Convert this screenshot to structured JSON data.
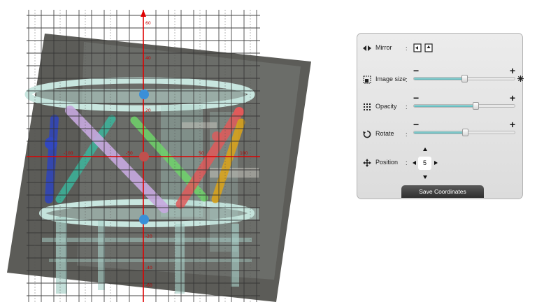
{
  "viewer": {
    "x_ticks": [
      "-100",
      "-50",
      "50",
      "100"
    ],
    "y_ticks_top": [
      "60",
      "40",
      "20"
    ],
    "y_ticks_bottom": [
      "-20",
      "-40",
      "-60"
    ]
  },
  "panel": {
    "mirror": {
      "label": "Mirror",
      "icon": "mirror-icon"
    },
    "image_size": {
      "label": "Image size",
      "minus": "−",
      "plus": "+",
      "value": 0.5,
      "icon": "image-size-icon"
    },
    "opacity": {
      "label": "Opacity",
      "minus": "−",
      "plus": "+",
      "value": 0.61,
      "icon": "opacity-icon"
    },
    "rotate": {
      "label": "Rotate",
      "minus": "−",
      "plus": "+",
      "value": 0.51,
      "icon": "rotate-icon"
    },
    "position": {
      "label": "Position",
      "value": "5",
      "icon": "position-icon"
    },
    "colon": ":",
    "save_label": "Save Coordinates"
  },
  "colors": {
    "axis": "#e00000",
    "grid": "#3a3a3a",
    "slider_fill": "#5ab4b8",
    "button": "#3c3c3c"
  }
}
